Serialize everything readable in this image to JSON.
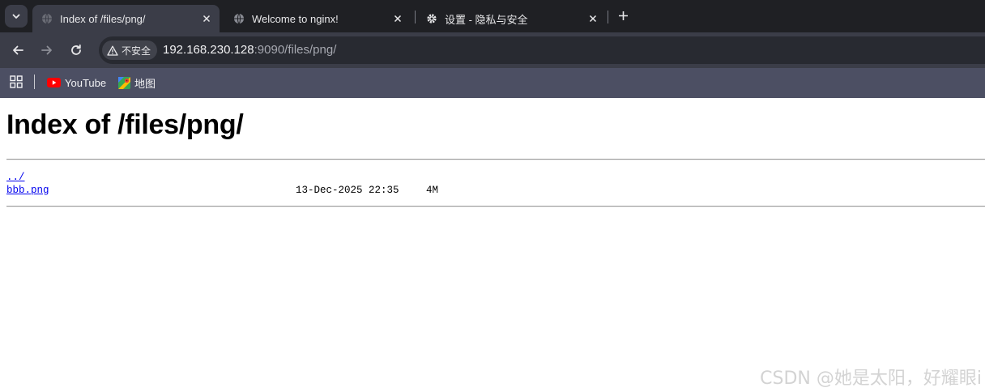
{
  "browser": {
    "tabs": [
      {
        "title": "Index of /files/png/",
        "icon": "globe-icon",
        "active": true
      },
      {
        "title": "Welcome to nginx!",
        "icon": "globe-icon",
        "active": false
      },
      {
        "title": "设置 - 隐私与安全",
        "icon": "gear-icon",
        "active": false
      }
    ],
    "security_label": "不安全",
    "url_host": "192.168.230.128",
    "url_rest": ":9090/files/png/",
    "bookmarks": [
      {
        "label": "YouTube",
        "icon": "youtube-icon"
      },
      {
        "label": "地图",
        "icon": "maps-icon"
      }
    ]
  },
  "page": {
    "heading": "Index of /files/png/",
    "entries": [
      {
        "name": "../",
        "date": "",
        "size": ""
      },
      {
        "name": "bbb.png",
        "date": "13-Dec-2025 22:35",
        "size": "4M"
      }
    ]
  },
  "watermark": "CSDN @她是太阳，好耀眼i",
  "colors": {
    "tabstrip": "#1f2024",
    "toolbar": "#3b3d48",
    "bookmarks_bar": "#4c4f63",
    "link": "#0000ee"
  }
}
